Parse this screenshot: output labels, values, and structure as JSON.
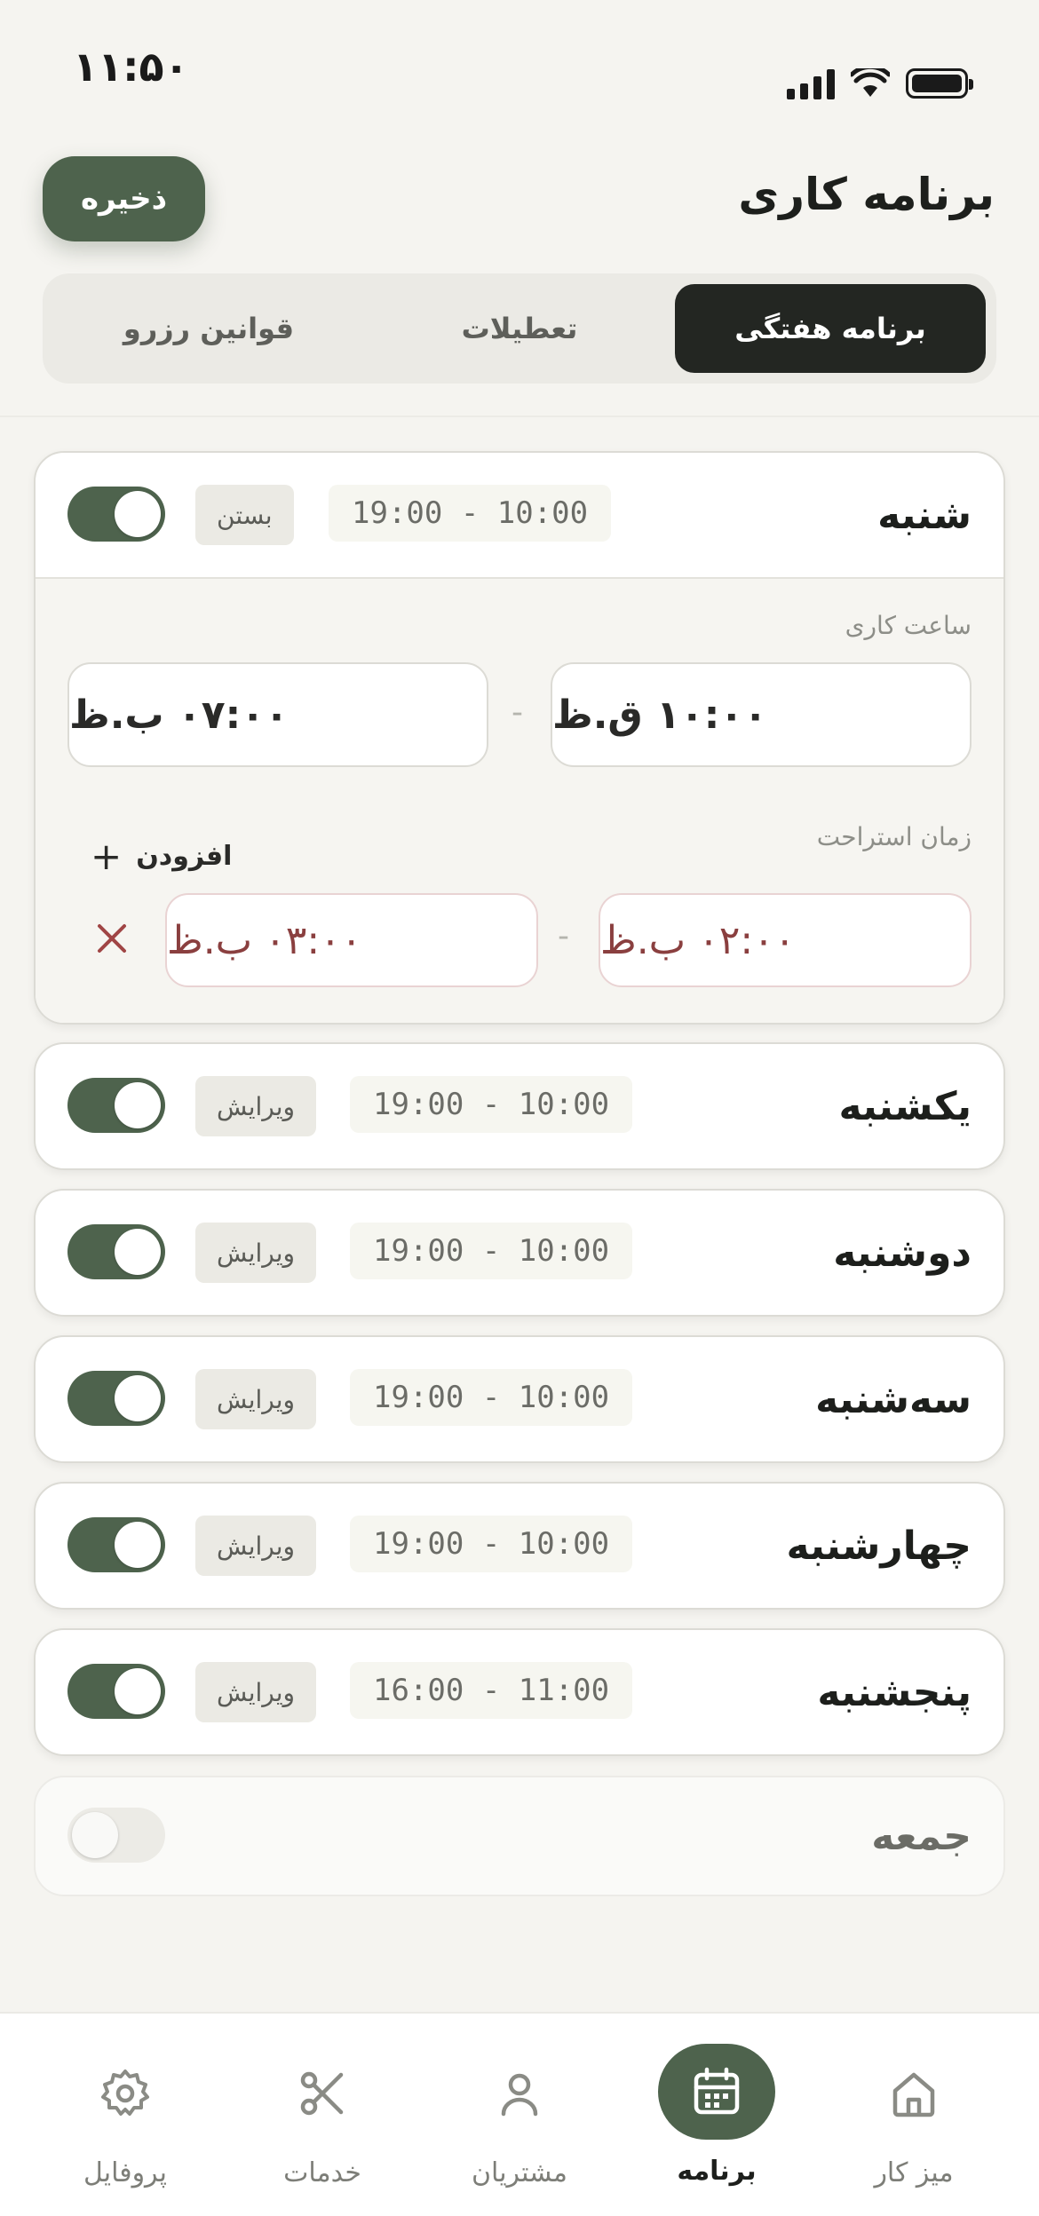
{
  "status_bar": {
    "time": "۱۱:۵۰"
  },
  "header": {
    "title": "برنامه کاری",
    "save_label": "ذخیره"
  },
  "tabs": [
    {
      "label": "برنامه هفتگی",
      "active": true
    },
    {
      "label": "تعطیلات",
      "active": false
    },
    {
      "label": "قوانین رزرو",
      "active": false
    }
  ],
  "days": [
    {
      "name": "شنبه",
      "hours": "19:00 - 10:00",
      "action": "بستن",
      "enabled": true,
      "expanded": true
    },
    {
      "name": "یکشنبه",
      "hours": "19:00 - 10:00",
      "action": "ویرایش",
      "enabled": true
    },
    {
      "name": "دوشنبه",
      "hours": "19:00 - 10:00",
      "action": "ویرایش",
      "enabled": true
    },
    {
      "name": "سه‌شنبه",
      "hours": "19:00 - 10:00",
      "action": "ویرایش",
      "enabled": true
    },
    {
      "name": "چهارشنبه",
      "hours": "19:00 - 10:00",
      "action": "ویرایش",
      "enabled": true
    },
    {
      "name": "پنجشنبه",
      "hours": "16:00 - 11:00",
      "action": "ویرایش",
      "enabled": true
    },
    {
      "name": "جمعه",
      "enabled": false
    }
  ],
  "expanded_panel": {
    "working_hours_label": "ساعت کاری",
    "start_time": "۱۰:۰۰ ق.ظ",
    "end_time": "۰۷:۰۰ ب.ظ",
    "break_label": "زمان استراحت",
    "add_label": "افزودن",
    "break_start": "۰۲:۰۰ ب.ظ",
    "break_end": "۰۳:۰۰ ب.ظ"
  },
  "nav": [
    {
      "label": "میز کار",
      "icon": "home-icon",
      "active": false
    },
    {
      "label": "برنامه",
      "icon": "calendar-icon",
      "active": true
    },
    {
      "label": "مشتریان",
      "icon": "user-icon",
      "active": false
    },
    {
      "label": "خدمات",
      "icon": "scissors-icon",
      "active": false
    },
    {
      "label": "پروفایل",
      "icon": "gear-icon",
      "active": false
    }
  ],
  "colors": {
    "accent": "#4e634d",
    "dark_tab": "#232622",
    "break_text": "#8a3f3f",
    "background": "#f5f4f0"
  }
}
